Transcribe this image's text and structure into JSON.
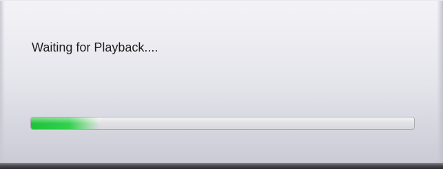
{
  "dialog": {
    "message": "Waiting for Playback....",
    "progress": {
      "value_percent": 18,
      "fill_color": "#2bcb44"
    }
  }
}
